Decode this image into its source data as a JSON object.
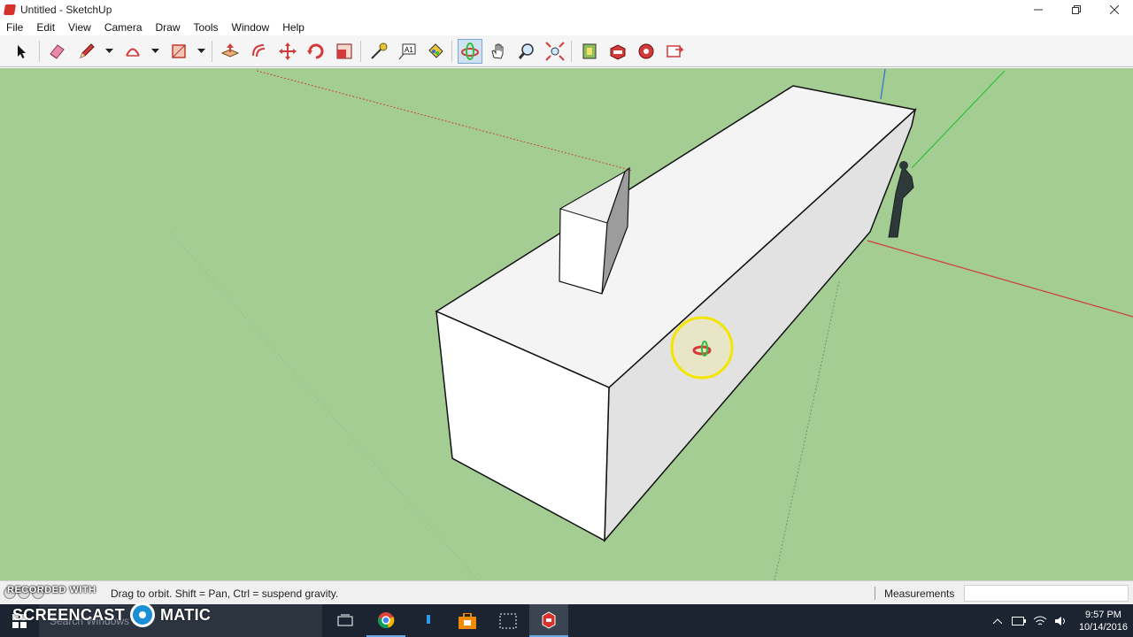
{
  "window": {
    "title": "Untitled - SketchUp",
    "controls": [
      "minimize",
      "restore",
      "close"
    ]
  },
  "menu": [
    "File",
    "Edit",
    "View",
    "Camera",
    "Draw",
    "Tools",
    "Window",
    "Help"
  ],
  "toolbar": {
    "tools": [
      {
        "name": "select",
        "icon": "select-arrow-icon"
      },
      {
        "name": "eraser",
        "icon": "eraser-icon"
      },
      {
        "name": "line",
        "icon": "pencil-icon",
        "dropdown": true
      },
      {
        "name": "arc",
        "icon": "arc-icon",
        "dropdown": true
      },
      {
        "name": "rectangle",
        "icon": "rectangle-icon",
        "dropdown": true
      },
      {
        "name": "push-pull",
        "icon": "push-pull-icon"
      },
      {
        "name": "offset",
        "icon": "offset-icon"
      },
      {
        "name": "move",
        "icon": "move-icon"
      },
      {
        "name": "rotate",
        "icon": "rotate-icon"
      },
      {
        "name": "scale",
        "icon": "scale-icon"
      },
      {
        "name": "tape-measure",
        "icon": "tape-measure-icon"
      },
      {
        "name": "text",
        "icon": "text-icon"
      },
      {
        "name": "paint-bucket",
        "icon": "paint-bucket-icon"
      },
      {
        "name": "orbit",
        "icon": "orbit-icon",
        "active": true
      },
      {
        "name": "pan",
        "icon": "hand-icon"
      },
      {
        "name": "zoom",
        "icon": "zoom-icon"
      },
      {
        "name": "zoom-extents",
        "icon": "zoom-extents-icon"
      },
      {
        "name": "3d-warehouse",
        "icon": "warehouse-icon"
      },
      {
        "name": "extension-warehouse",
        "icon": "extension-warehouse-icon"
      },
      {
        "name": "extension-manager",
        "icon": "extension-manager-icon"
      },
      {
        "name": "send-to-layout",
        "icon": "layout-icon"
      }
    ]
  },
  "statusbar": {
    "hint": "Drag to orbit. Shift = Pan, Ctrl = suspend gravity.",
    "measurements_label": "Measurements",
    "measurements_value": ""
  },
  "watermark": {
    "top": "RECORDED WITH",
    "brand_left": "SCREENCAST",
    "brand_right": "MATIC"
  },
  "taskbar": {
    "search_placeholder": "Search Windows",
    "apps": [
      "task-view",
      "chrome",
      "pin",
      "store",
      "snipping-tool",
      "sketchup"
    ],
    "time": "9:57 PM",
    "date": "10/14/2016"
  },
  "colors": {
    "viewport_bg": "#a3cd93",
    "axis_red": "#d33a3a",
    "axis_green": "#2fbf3a",
    "axis_blue": "#2e6fd8",
    "orbit_highlight": "#f4e500",
    "sketchup_brand": "#d6312a"
  }
}
